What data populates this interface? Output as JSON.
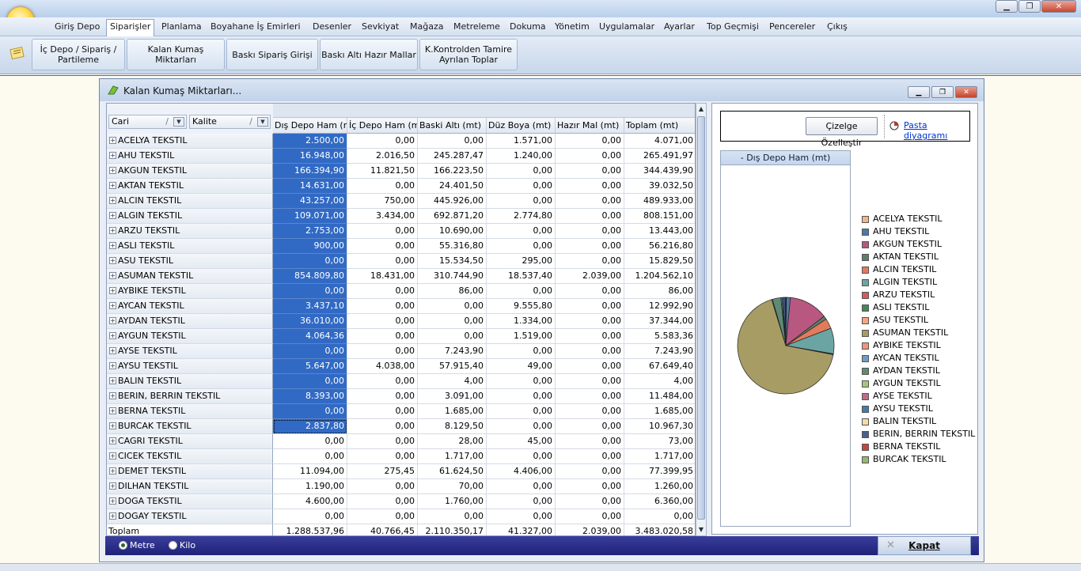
{
  "menu": {
    "items": [
      "Giriş Depo",
      "Siparişler",
      "Planlama",
      "Boyahane İş Emirleri",
      "Desenler",
      "Sevkiyat",
      "Mağaza",
      "Metreleme",
      "Dokuma",
      "Yönetim",
      "Uygulamalar",
      "Ayarlar",
      "Top Geçmişi",
      "Pencereler",
      "Çıkış"
    ],
    "active": "Siparişler"
  },
  "ribbon": {
    "buttons": [
      "İç Depo / Sipariş / Partileme",
      "Kalan Kumaş Miktarları",
      "Baskı Sipariş Girişi",
      "Baskı Altı Hazır Mallar",
      "K.Kontrolden Tamire Ayrılan Toplar"
    ]
  },
  "window": {
    "title": "Kalan Kumaş Miktarları..."
  },
  "grid": {
    "filters": [
      "Cari",
      "Kalite"
    ],
    "columns": [
      "Dış Depo Ham (mt)",
      "İç Depo Ham (mt)",
      "Baski Altı (mt)",
      "Düz Boya (mt)",
      "Hazır Mal (mt)",
      "Toplam (mt)"
    ],
    "rows": [
      {
        "name": "ACELYA TEKSTIL",
        "values": [
          "2.500,00",
          "0,00",
          "0,00",
          "1.571,00",
          "0,00",
          "4.071,00"
        ]
      },
      {
        "name": "AHU TEKSTIL",
        "values": [
          "16.948,00",
          "2.016,50",
          "245.287,47",
          "1.240,00",
          "0,00",
          "265.491,97"
        ]
      },
      {
        "name": "AKGUN TEKSTIL",
        "values": [
          "166.394,90",
          "11.821,50",
          "166.223,50",
          "0,00",
          "0,00",
          "344.439,90"
        ]
      },
      {
        "name": "AKTAN TEKSTIL",
        "values": [
          "14.631,00",
          "0,00",
          "24.401,50",
          "0,00",
          "0,00",
          "39.032,50"
        ]
      },
      {
        "name": "ALCIN TEKSTIL",
        "values": [
          "43.257,00",
          "750,00",
          "445.926,00",
          "0,00",
          "0,00",
          "489.933,00"
        ]
      },
      {
        "name": "ALGIN TEKSTIL",
        "values": [
          "109.071,00",
          "3.434,00",
          "692.871,20",
          "2.774,80",
          "0,00",
          "808.151,00"
        ]
      },
      {
        "name": "ARZU TEKSTIL",
        "values": [
          "2.753,00",
          "0,00",
          "10.690,00",
          "0,00",
          "0,00",
          "13.443,00"
        ]
      },
      {
        "name": "ASLI TEKSTIL",
        "values": [
          "900,00",
          "0,00",
          "55.316,80",
          "0,00",
          "0,00",
          "56.216,80"
        ]
      },
      {
        "name": "ASU TEKSTIL",
        "values": [
          "0,00",
          "0,00",
          "15.534,50",
          "295,00",
          "0,00",
          "15.829,50"
        ]
      },
      {
        "name": "ASUMAN TEKSTIL",
        "values": [
          "854.809,80",
          "18.431,00",
          "310.744,90",
          "18.537,40",
          "2.039,00",
          "1.204.562,10"
        ]
      },
      {
        "name": "AYBIKE TEKSTIL",
        "values": [
          "0,00",
          "0,00",
          "86,00",
          "0,00",
          "0,00",
          "86,00"
        ]
      },
      {
        "name": "AYCAN TEKSTIL",
        "values": [
          "3.437,10",
          "0,00",
          "0,00",
          "9.555,80",
          "0,00",
          "12.992,90"
        ]
      },
      {
        "name": "AYDAN TEKSTIL",
        "values": [
          "36.010,00",
          "0,00",
          "0,00",
          "1.334,00",
          "0,00",
          "37.344,00"
        ]
      },
      {
        "name": "AYGUN TEKSTIL",
        "values": [
          "4.064,36",
          "0,00",
          "0,00",
          "1.519,00",
          "0,00",
          "5.583,36"
        ]
      },
      {
        "name": "AYSE TEKSTIL",
        "values": [
          "0,00",
          "0,00",
          "7.243,90",
          "0,00",
          "0,00",
          "7.243,90"
        ]
      },
      {
        "name": "AYSU TEKSTIL",
        "values": [
          "5.647,00",
          "4.038,00",
          "57.915,40",
          "49,00",
          "0,00",
          "67.649,40"
        ]
      },
      {
        "name": "BALIN TEKSTIL",
        "values": [
          "0,00",
          "0,00",
          "4,00",
          "0,00",
          "0,00",
          "4,00"
        ]
      },
      {
        "name": "BERIN, BERRIN TEKSTIL",
        "values": [
          "8.393,00",
          "0,00",
          "3.091,00",
          "0,00",
          "0,00",
          "11.484,00"
        ]
      },
      {
        "name": "BERNA TEKSTIL",
        "values": [
          "0,00",
          "0,00",
          "1.685,00",
          "0,00",
          "0,00",
          "1.685,00"
        ]
      },
      {
        "name": "BURCAK TEKSTIL",
        "values": [
          "2.837,80",
          "0,00",
          "8.129,50",
          "0,00",
          "0,00",
          "10.967,30"
        ]
      },
      {
        "name": "CAGRI TEKSTIL",
        "values": [
          "0,00",
          "0,00",
          "28,00",
          "45,00",
          "0,00",
          "73,00"
        ]
      },
      {
        "name": "CICEK TEKSTIL",
        "values": [
          "0,00",
          "0,00",
          "1.717,00",
          "0,00",
          "0,00",
          "1.717,00"
        ]
      },
      {
        "name": "DEMET TEKSTIL",
        "values": [
          "11.094,00",
          "275,45",
          "61.624,50",
          "4.406,00",
          "0,00",
          "77.399,95"
        ]
      },
      {
        "name": "DILHAN TEKSTIL",
        "values": [
          "1.190,00",
          "0,00",
          "70,00",
          "0,00",
          "0,00",
          "1.260,00"
        ]
      },
      {
        "name": "DOGA TEKSTIL",
        "values": [
          "4.600,00",
          "0,00",
          "1.760,00",
          "0,00",
          "0,00",
          "6.360,00"
        ]
      },
      {
        "name": "DOGAY TEKSTIL",
        "values": [
          "0,00",
          "0,00",
          "0,00",
          "0,00",
          "0,00",
          "0,00"
        ]
      }
    ],
    "total": {
      "name": "Toplam",
      "values": [
        "1.288.537,96",
        "40.766,45",
        "2.110.350,17",
        "41.327,00",
        "2.039,00",
        "3.483.020,58"
      ]
    }
  },
  "chart": {
    "customize_label": "Çizelge Özelleştir",
    "pie_link": "Pasta diyagramı",
    "panel_title": "- Dış Depo Ham (mt)"
  },
  "chart_data": {
    "type": "pie",
    "title": "- Dış Depo Ham (mt)",
    "categories": [
      "ACELYA TEKSTIL",
      "AHU TEKSTIL",
      "AKGUN TEKSTIL",
      "AKTAN TEKSTIL",
      "ALCIN TEKSTIL",
      "ALGIN TEKSTIL",
      "ARZU TEKSTIL",
      "ASLI TEKSTIL",
      "ASU TEKSTIL",
      "ASUMAN TEKSTIL",
      "AYBIKE TEKSTIL",
      "AYCAN TEKSTIL",
      "AYDAN TEKSTIL",
      "AYGUN TEKSTIL",
      "AYSE TEKSTIL",
      "AYSU TEKSTIL",
      "BALIN TEKSTIL",
      "BERIN, BERRIN TEKSTIL",
      "BERNA TEKSTIL",
      "BURCAK TEKSTIL"
    ],
    "values": [
      2500,
      16948,
      166394.9,
      14631,
      43257,
      109071,
      2753,
      900,
      0,
      854809.8,
      0,
      3437.1,
      36010,
      4064.36,
      0,
      5647,
      0,
      8393,
      0,
      2837.8
    ],
    "colors": [
      "#f3b48a",
      "#4d79a8",
      "#b8577f",
      "#5d7f6a",
      "#e47a5c",
      "#6aa5a3",
      "#d35d5d",
      "#3f8a57",
      "#f4a77a",
      "#a79c63",
      "#f0957a",
      "#6f9cc2",
      "#5f8a75",
      "#a9c47e",
      "#c06b86",
      "#3f7faa",
      "#f6dba3",
      "#4a5f8c",
      "#c8453d",
      "#9bb66b"
    ],
    "legend": "right"
  },
  "footer": {
    "options": [
      "Metre",
      "Kilo"
    ],
    "selected": "Metre",
    "close_label": "Kapat"
  }
}
